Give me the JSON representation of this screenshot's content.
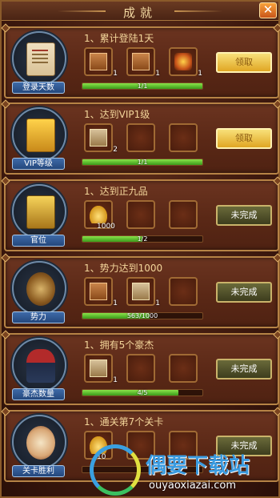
{
  "header": {
    "title": "成就",
    "close_icon": "close-icon"
  },
  "cards": [
    {
      "medal_caption": "登录天数",
      "medal_icon": "scroll-icon",
      "task": "1、累计登陆1天",
      "rewards": [
        {
          "icon": "card-icon",
          "count": "1"
        },
        {
          "icon": "card-icon",
          "count": "1"
        },
        {
          "icon": "lamp-icon",
          "count": "1"
        }
      ],
      "progress_text": "1/1",
      "progress_fraction": 1.0,
      "button": "领取",
      "button_state": "claim"
    },
    {
      "medal_caption": "VIP等级",
      "medal_icon": "vip-icon",
      "task": "1、达到VIP1级",
      "rewards": [
        {
          "icon": "card-icon",
          "count": "2"
        },
        {
          "icon": "empty",
          "count": ""
        },
        {
          "icon": "empty",
          "count": ""
        }
      ],
      "progress_text": "1/1",
      "progress_fraction": 1.0,
      "button": "领取",
      "button_state": "claim"
    },
    {
      "medal_caption": "官位",
      "medal_icon": "seal-icon",
      "task": "1、达到正九品",
      "rewards": [
        {
          "icon": "gold-ingot-icon",
          "count": "1000"
        },
        {
          "icon": "empty",
          "count": ""
        },
        {
          "icon": "empty",
          "count": ""
        }
      ],
      "progress_text": "1/2",
      "progress_fraction": 0.5,
      "button": "未完成",
      "button_state": "incomplete"
    },
    {
      "medal_caption": "势力",
      "medal_icon": "jade-icon",
      "task": "1、势力达到1000",
      "rewards": [
        {
          "icon": "card-icon",
          "count": "1"
        },
        {
          "icon": "card2-icon",
          "count": "1"
        },
        {
          "icon": "empty",
          "count": ""
        }
      ],
      "progress_text": "563/1000",
      "progress_fraction": 0.563,
      "button": "未完成",
      "button_state": "incomplete"
    },
    {
      "medal_caption": "豪杰数量",
      "medal_icon": "hero-icon",
      "task": "1、拥有5个豪杰",
      "rewards": [
        {
          "icon": "card2-icon",
          "count": "1"
        },
        {
          "icon": "empty",
          "count": ""
        },
        {
          "icon": "empty",
          "count": ""
        }
      ],
      "progress_text": "4/5",
      "progress_fraction": 0.8,
      "button": "未完成",
      "button_state": "incomplete"
    },
    {
      "medal_caption": "关卡胜利",
      "medal_icon": "coin-icon",
      "task": "1、通关第7个关卡",
      "rewards": [
        {
          "icon": "gold-ingot-icon",
          "count": "10"
        },
        {
          "icon": "empty",
          "count": ""
        },
        {
          "icon": "empty",
          "count": ""
        }
      ],
      "progress_text": "",
      "progress_fraction": 0.0,
      "button": "未完成",
      "button_state": "incomplete"
    }
  ],
  "watermark": {
    "title": "偶要下载站",
    "url": "ouyaoxiazai.com"
  }
}
